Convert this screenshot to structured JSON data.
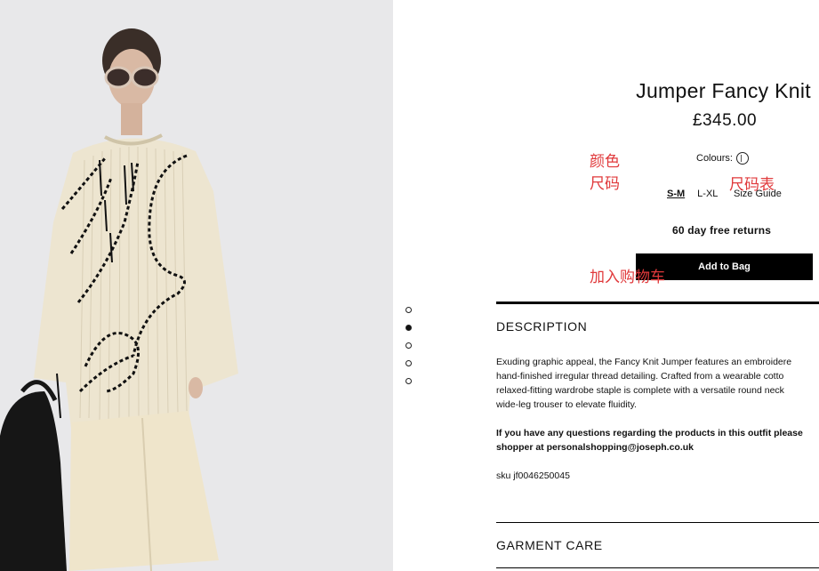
{
  "product": {
    "title": "Jumper Fancy Knit",
    "price": "£345.00",
    "colours_label": "Colours:",
    "sizes": [
      "S-M",
      "L-XL"
    ],
    "selected_size": "S-M",
    "size_guide": "Size Guide",
    "returns": "60 day free returns",
    "add_to_bag": "Add to Bag"
  },
  "annotations": {
    "colour": "颜色",
    "size": "尺码",
    "size_chart": "尺码表",
    "add_to_cart": "加入购物车"
  },
  "carousel": {
    "count": 5,
    "active_index": 1
  },
  "description": {
    "heading": "DESCRIPTION",
    "lines": [
      "Exuding graphic appeal, the Fancy Knit Jumper features an embroidere",
      "hand-finished irregular thread detailing. Crafted from a wearable cotto",
      "relaxed-fitting wardrobe staple is complete with a versatile round neck",
      "wide-leg trouser to elevate fluidity."
    ],
    "contact_lines": [
      "If you have any questions regarding the products in this outfit please",
      "shopper at personalshopping@joseph.co.uk"
    ],
    "sku": "sku jf0046250045"
  },
  "garment_care": {
    "heading": "GARMENT CARE"
  },
  "colors": {
    "annotation": "#e0393b",
    "button": "#000000"
  }
}
